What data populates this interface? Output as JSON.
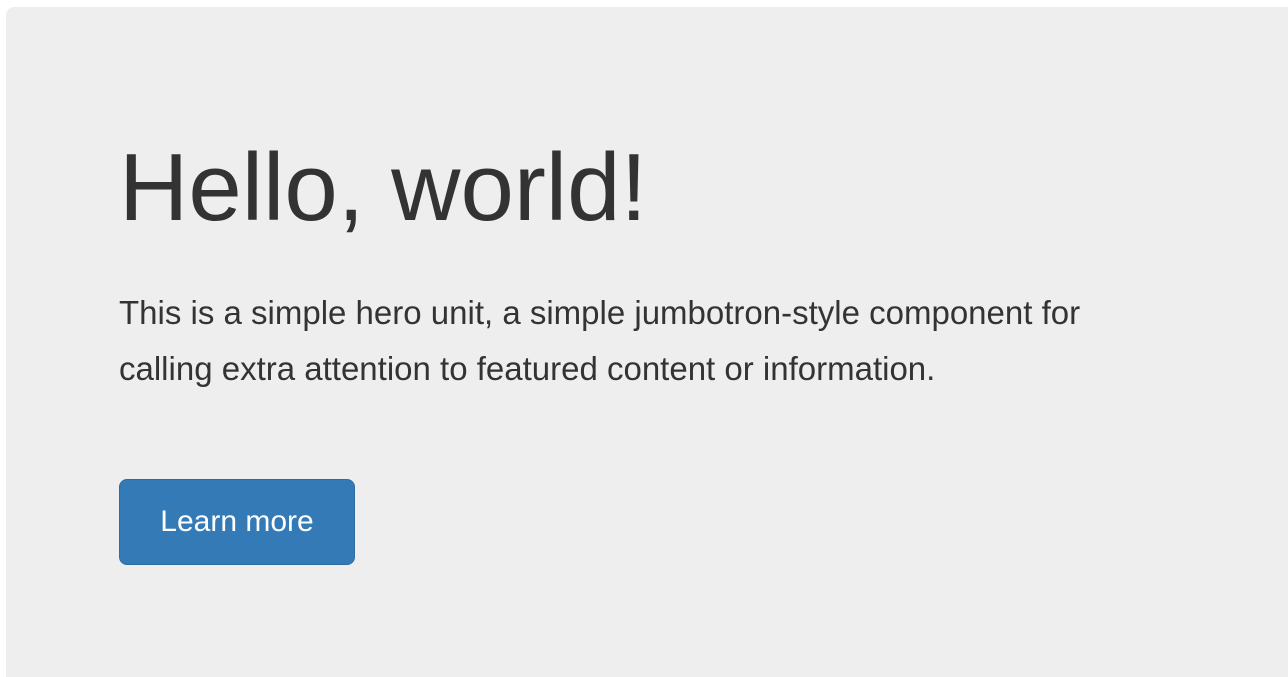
{
  "hero": {
    "title": "Hello, world!",
    "description": "This is a simple hero unit, a simple jumbotron-style component for calling extra attention to featured content or information.",
    "button_label": "Learn more"
  },
  "colors": {
    "background": "#eeeeee",
    "text": "#333333",
    "button_primary": "#337ab7",
    "button_text": "#ffffff"
  }
}
